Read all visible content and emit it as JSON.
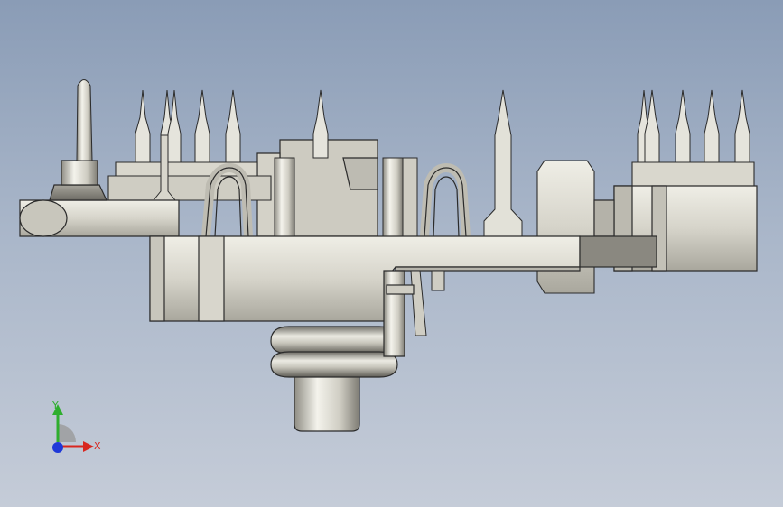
{
  "viewport": {
    "background_top": "#8a9cb6",
    "background_bottom": "#c5ccd8"
  },
  "model": {
    "view": "front",
    "body_color": "#d6d4ca",
    "shadow_color": "#8f8d84",
    "edge_color": "#2b2b2b",
    "highlight_color": "#f2f1ea"
  },
  "triad": {
    "x_label": "X",
    "y_label": "Y",
    "x_color": "#d8261f",
    "y_color": "#2eae2e",
    "z_color": "#1f39d8"
  }
}
